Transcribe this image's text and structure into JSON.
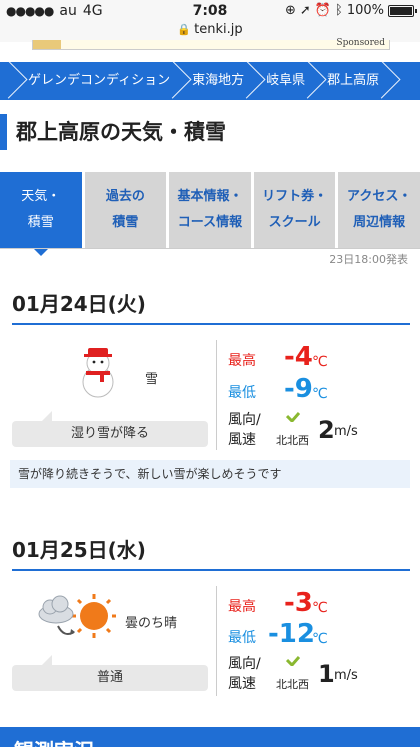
{
  "status_bar": {
    "carrier": "au",
    "network": "4G",
    "time": "7:08",
    "battery": "100%"
  },
  "url": "tenki.jp",
  "ad": {
    "sponsored": "Sponsored"
  },
  "breadcrumb": [
    "ゲレンデコンディション",
    "東海地方",
    "岐阜県",
    "郡上高原"
  ],
  "page_title": "郡上高原の天気・積雪",
  "tabs": [
    {
      "line1": "天気・",
      "line2": "積雪",
      "active": true
    },
    {
      "line1": "過去の",
      "line2": "積雪",
      "active": false
    },
    {
      "line1": "基本情報・",
      "line2": "コース情報",
      "active": false
    },
    {
      "line1": "リフト券・",
      "line2": "スクール",
      "active": false
    },
    {
      "line1": "アクセス・",
      "line2": "周辺情報",
      "active": false
    }
  ],
  "issued": "23日18:00発表",
  "days": [
    {
      "date": "01月24日(火)",
      "icon": "snowman-icon",
      "weather": "雪",
      "condition": "湿り雪が降る",
      "high_label": "最高",
      "high": "-4",
      "low_label": "最低",
      "low": "-9",
      "unit": "℃",
      "wind_label_1": "風向/",
      "wind_label_2": "風速",
      "wind_dir": "北北西",
      "wind_speed": "2",
      "wind_unit": "m/s",
      "comment": "雪が降り続きそうで、新しい雪が楽しめそうです"
    },
    {
      "date": "01月25日(水)",
      "icon": "cloudy-then-sunny-icon",
      "weather": "曇のち晴",
      "condition": "普通",
      "high_label": "最高",
      "high": "-3",
      "low_label": "最低",
      "low": "-12",
      "unit": "℃",
      "wind_label_1": "風向/",
      "wind_label_2": "風速",
      "wind_dir": "北北西",
      "wind_speed": "1",
      "wind_unit": "m/s"
    }
  ],
  "footer_heading": "観測実況",
  "colors": {
    "brand_blue": "#1f6ed4",
    "high": "#e8221c",
    "low": "#1a8fe0"
  }
}
